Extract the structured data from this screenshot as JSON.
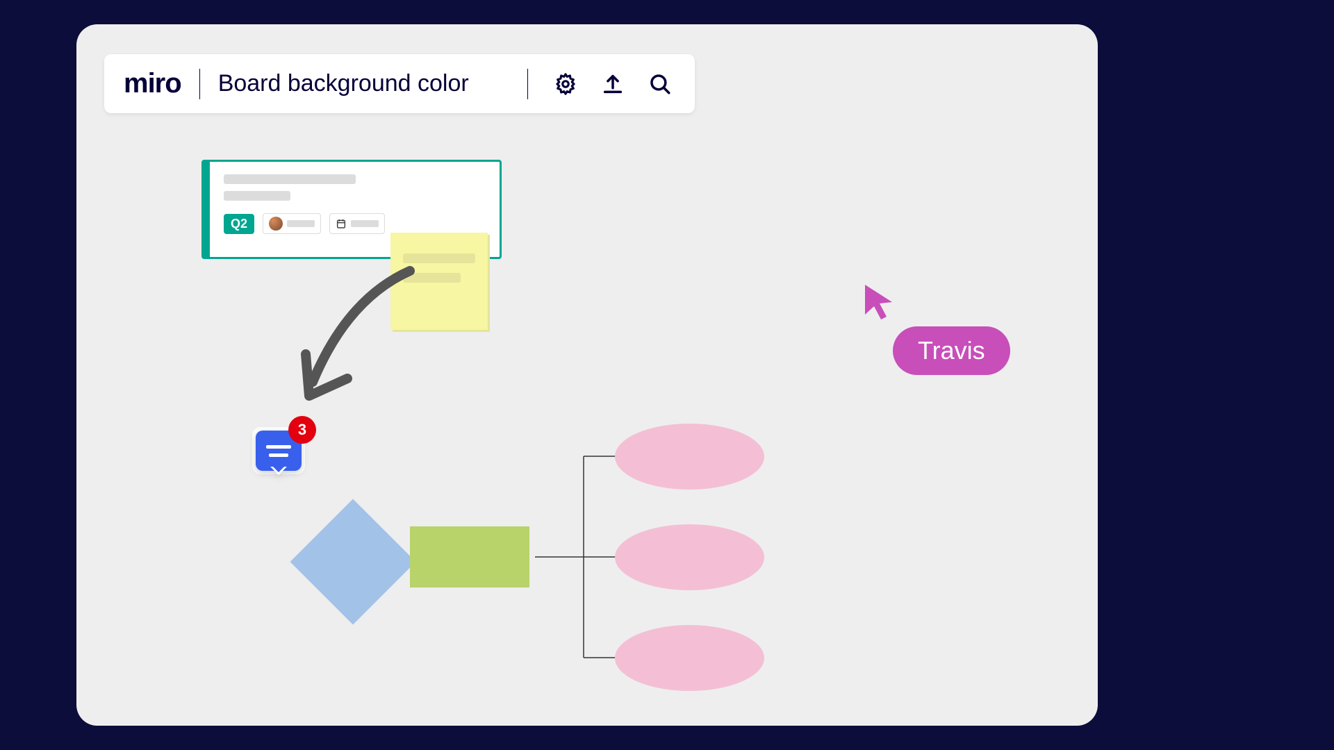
{
  "toolbar": {
    "logo": "miro",
    "title": "Board background color"
  },
  "card": {
    "tag": "Q2"
  },
  "comment": {
    "count": "3"
  },
  "cursor": {
    "user": "Travis"
  },
  "colors": {
    "diamond": "#a3c2e8",
    "rect": "#b7d36a",
    "ellipse": "#f4bfd4",
    "sticky": "#f7f6a2",
    "cardAccent": "#00a68f",
    "cursor": "#c84eba",
    "comment": "#3860ed",
    "badge": "#e3000f"
  }
}
